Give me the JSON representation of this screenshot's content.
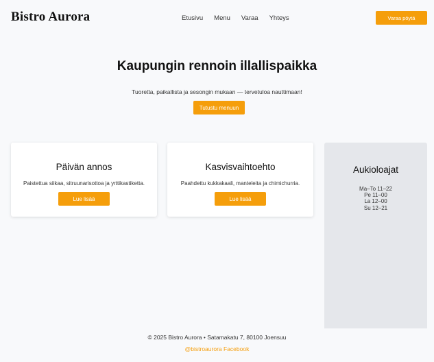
{
  "header": {
    "logo": "Bistro Aurora",
    "nav": [
      "Etusivu",
      "Menu",
      "Varaa",
      "Yhteys"
    ],
    "reserve_label": "Varaa pöytä"
  },
  "hero": {
    "title": "Kaupungin rennoin illallispaikka",
    "subtitle": "Tuoretta, paikallista ja sesongin mukaan — tervetuloa nauttimaan!",
    "cta_label": "Tutustu menuun"
  },
  "cards": [
    {
      "title": "Päivän annos",
      "description": "Paistettua siikaa, sitruunarisottoa ja yrttikastiketta.",
      "button_label": "Lue lisää"
    },
    {
      "title": "Kasvisvaihtoehto",
      "description": "Paahdettu kukkakaali, manteleita ja chimichurria.",
      "button_label": "Lue lisää"
    }
  ],
  "hours": {
    "title": "Aukioloajat",
    "rows": [
      "Ma–To 11–22",
      "Pe 11–00",
      "La 12–00",
      "Su 12–21"
    ]
  },
  "footer": {
    "copyright": "© 2025 Bistro Aurora • Satamakatu 7, 80100 Joensuu",
    "social_instagram": "@bistroaurora",
    "social_facebook": "Facebook"
  },
  "colors": {
    "accent": "#f59e0b",
    "background": "#f8f9fb",
    "sidebar": "#e5e7eb"
  }
}
